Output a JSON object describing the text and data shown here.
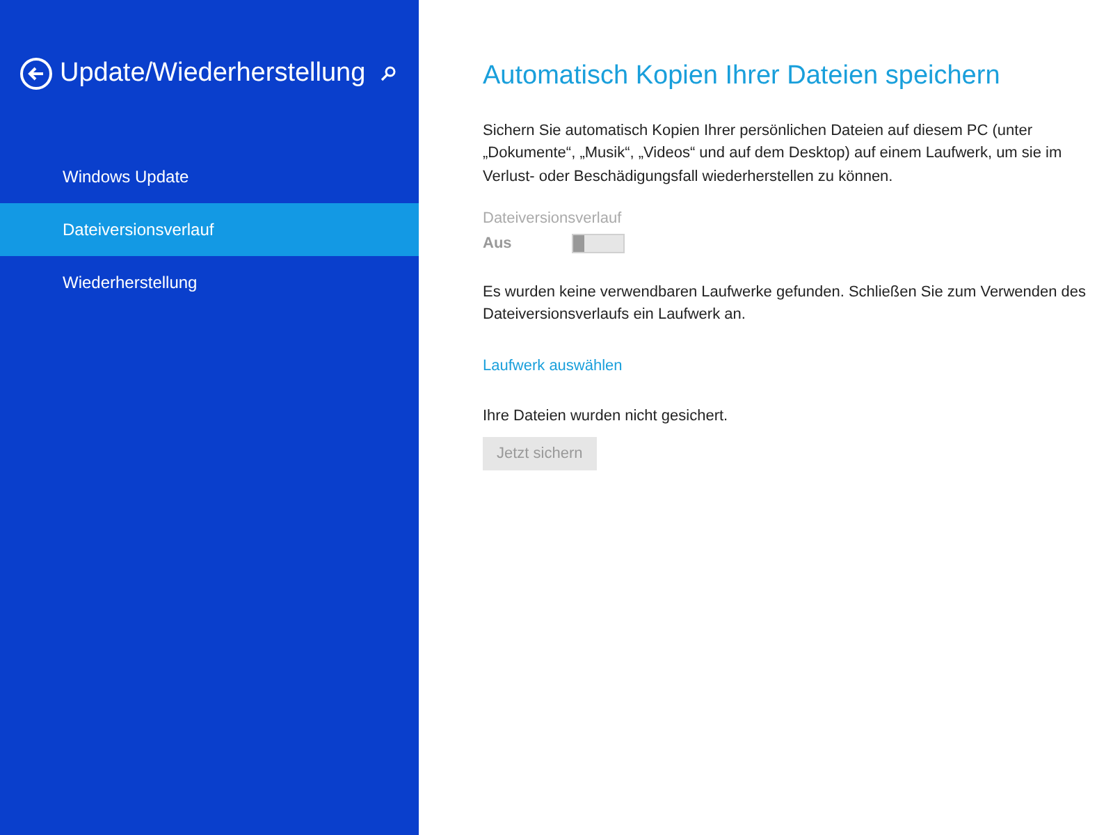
{
  "sidebar": {
    "title": "Update/Wiederherstellung",
    "items": [
      {
        "label": "Windows Update",
        "selected": false
      },
      {
        "label": "Dateiversionsverlauf",
        "selected": true
      },
      {
        "label": "Wiederherstellung",
        "selected": false
      }
    ]
  },
  "content": {
    "heading": "Automatisch Kopien Ihrer Dateien speichern",
    "description": "Sichern Sie automatisch Kopien Ihrer persönlichen Dateien auf diesem PC (unter „Dokumente“, „Musik“, „Videos“ und auf dem Desktop) auf einem Laufwerk, um sie im Verlust- oder Beschädigungsfall wiederherstellen zu können.",
    "toggle": {
      "label": "Dateiversionsverlauf",
      "state_text": "Aus",
      "on": false,
      "disabled": true
    },
    "notice": "Es wurden keine verwendbaren Laufwerke gefunden. Schließen Sie zum Verwenden des Dateiversionsverlaufs ein Laufwerk an.",
    "link": "Laufwerk auswählen",
    "status": "Ihre Dateien wurden nicht gesichert.",
    "button": {
      "label": "Jetzt sichern",
      "disabled": true
    }
  }
}
